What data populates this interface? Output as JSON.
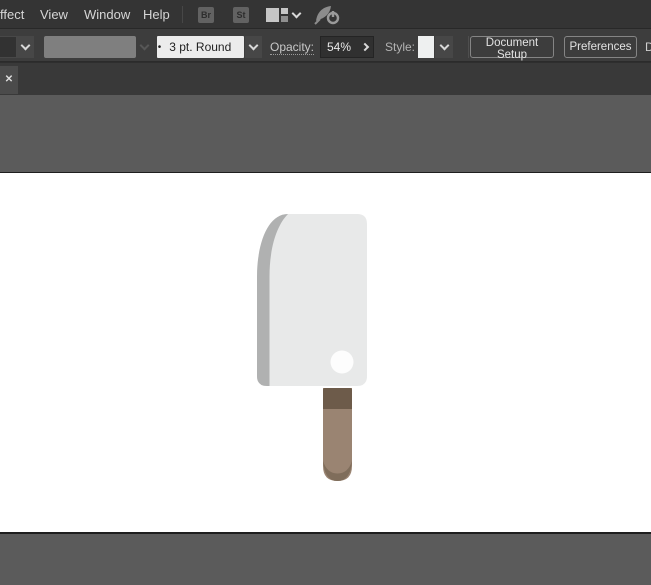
{
  "menubar": {
    "items": [
      {
        "label": "ffect"
      },
      {
        "label": "View"
      },
      {
        "label": "Window"
      },
      {
        "label": "Help"
      }
    ],
    "bridge_label": "Br",
    "stock_label": "St"
  },
  "controlbar": {
    "brush": {
      "bullet": "•",
      "value": "3 pt. Round"
    },
    "opacity": {
      "label": "Opacity:",
      "value": "54%"
    },
    "style": {
      "label": "Style:"
    },
    "document_setup_label": "Document Setup",
    "preferences_label": "Preferences",
    "cutoff_text": "D"
  },
  "tabbar": {
    "close_glyph": "✕"
  },
  "artwork": {
    "subject": "flat meat cleaver illustration",
    "colors": {
      "blade": "#e8e9e9",
      "blade_edge": "#b0b1b1",
      "hole": "#fdfdfd",
      "handle": "#9a8472",
      "handle_top": "#6d5b4a",
      "handle_shade": "#7f6d5b"
    }
  }
}
